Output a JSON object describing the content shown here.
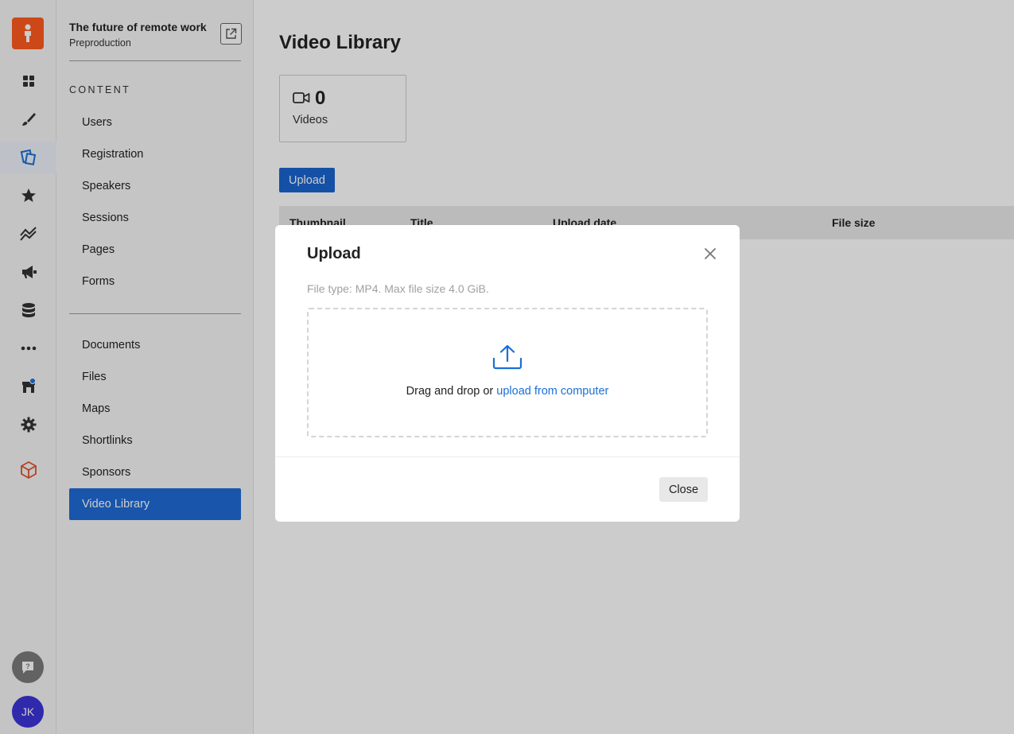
{
  "app": {
    "accent": "#1e6bd6",
    "logo_color": "#ff5a1f"
  },
  "rail": {
    "items": [
      {
        "icon": "grid-icon"
      },
      {
        "icon": "brush-icon"
      },
      {
        "icon": "content-icon",
        "active": true
      },
      {
        "icon": "star-icon"
      },
      {
        "icon": "analytics-icon"
      },
      {
        "icon": "megaphone-icon"
      },
      {
        "icon": "database-icon"
      },
      {
        "icon": "more-icon"
      },
      {
        "icon": "store-icon",
        "badge": true
      },
      {
        "icon": "gear-icon"
      },
      {
        "icon": "cube-icon"
      }
    ],
    "avatar_initials": "JK"
  },
  "sidebar": {
    "event_title": "The future of remote work",
    "event_stage": "Preproduction",
    "section_label": "CONTENT",
    "items": [
      {
        "label": "Users"
      },
      {
        "label": "Registration"
      },
      {
        "label": "Speakers"
      },
      {
        "label": "Sessions"
      },
      {
        "label": "Pages"
      },
      {
        "label": "Forms"
      }
    ],
    "items2": [
      {
        "label": "Documents"
      },
      {
        "label": "Files"
      },
      {
        "label": "Maps"
      },
      {
        "label": "Shortlinks"
      },
      {
        "label": "Sponsors"
      },
      {
        "label": "Video Library",
        "active": true
      }
    ]
  },
  "main": {
    "title": "Video Library",
    "stat": {
      "value": "0",
      "label": "Videos",
      "icon": "video-camera-icon"
    },
    "upload_label": "Upload",
    "table_headers": [
      "Thumbnail",
      "Title",
      "Upload date",
      "File size"
    ]
  },
  "modal": {
    "title": "Upload",
    "hint": "File type: MP4. Max file size 4.0 GiB.",
    "drop_text": "Drag and drop or",
    "drop_link": "upload from computer",
    "close_label": "Close"
  }
}
